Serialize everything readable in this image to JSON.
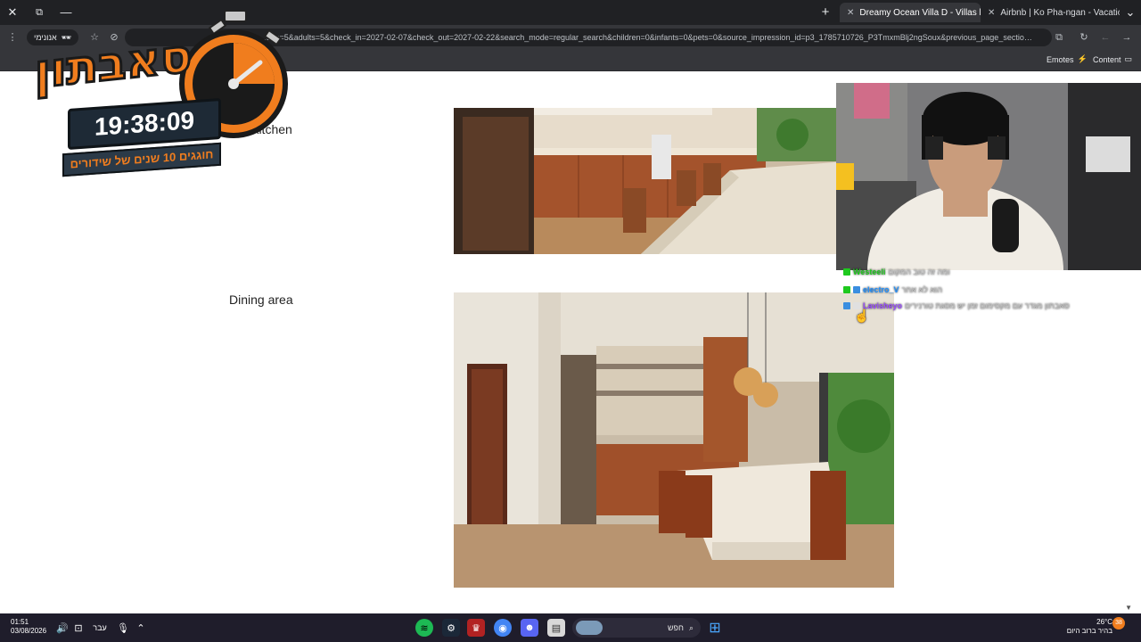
{
  "browser": {
    "window_controls": {
      "close": "✕",
      "restore": "⧉",
      "minimize": "—"
    },
    "new_tab": "+",
    "tabs": [
      {
        "label": "Dreamy Ocean Villa D - Villas h",
        "close": "✕"
      },
      {
        "label": "Airbnb | Ko Pha-ngan - Vacatio",
        "close": "✕"
      }
    ],
    "tab_search": "⌄",
    "incognito_label": "אנונימי",
    "url": "…ads=5&adults=5&check_in=2027-02-07&check_out=2027-02-22&search_mode=regular_search&children=0&infants=0&pets=0&source_impression_id=p3_1785710726_P3TmxmBlj2ngSoux&previous_page_sectio…",
    "bookmarks": {
      "emotes": "Emotes",
      "content": "Content"
    }
  },
  "page": {
    "sections": [
      {
        "label": "Full kitchen"
      },
      {
        "label": "Dining area"
      }
    ]
  },
  "chat": {
    "messages": [
      {
        "user": "Westeeli",
        "text": "ומה זה טוב המקום",
        "color": "#1ec91e"
      },
      {
        "user": "electro_V",
        "text": "הוא לא אחר",
        "color": "#1e90ff"
      },
      {
        "user": "Lavisheyo",
        "text": "סאבתון מגדר עם מקסימום זמן יש מסגת טורנירים",
        "color": "#9b4dff"
      }
    ]
  },
  "logo": {
    "title": "סאבתון",
    "timer": "19:38:09",
    "subtitle": "חוגגים 10 שנים של שידורים"
  },
  "taskbar": {
    "lang": "עבר",
    "time": "01:51",
    "date": "03/08/2026",
    "search_placeholder": "חפש",
    "weather_temp": "26°C",
    "weather_desc": "בהיר ברוב היום",
    "notification_count": "38"
  },
  "colors": {
    "chrome_dark": "#202124",
    "chrome_mid": "#35363a",
    "airbnb": "#ff385c",
    "taskbar": "#1f1d2b",
    "logo_orange": "#f07d1e"
  }
}
